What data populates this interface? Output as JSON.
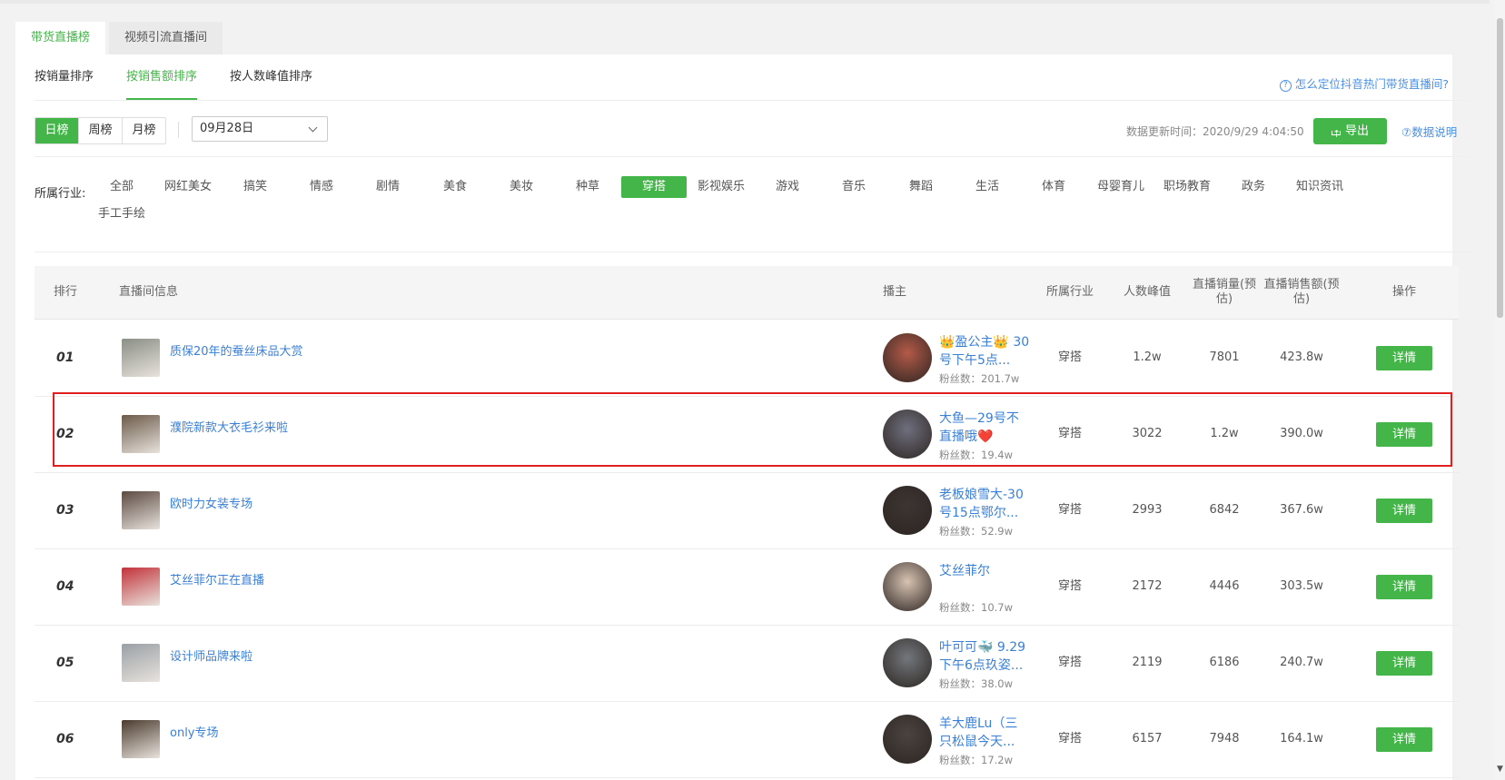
{
  "top_tabs": [
    "带货直播榜",
    "视频引流直播间"
  ],
  "sort_tabs": [
    "按销量排序",
    "按销售额排序",
    "按人数峰值排序"
  ],
  "help_link": "怎么定位抖音热门带货直播间?",
  "period_buttons": [
    "日榜",
    "周榜",
    "月榜"
  ],
  "date_value": "09月28日",
  "update_time": "数据更新时间：2020/9/29 4:04:50",
  "export_label": "导出",
  "data_explain": "⑦数据说明",
  "industry_label": "所属行业:",
  "industries": [
    "全部",
    "网红美女",
    "搞笑",
    "情感",
    "剧情",
    "美食",
    "美妆",
    "种草",
    "穿搭",
    "影视娱乐",
    "游戏",
    "音乐",
    "舞蹈",
    "生活",
    "体育",
    "母婴育儿",
    "职场教育",
    "政务",
    "知识资讯",
    "手工手绘"
  ],
  "active_industry": "穿搭",
  "table": {
    "headers": {
      "rank": "排行",
      "room": "直播间信息",
      "streamer": "播主",
      "industry": "所属行业",
      "peak": "人数峰值",
      "sales_volume": "直播销量(预估)",
      "sales_amount": "直播销售额(预估)",
      "action": "操作"
    },
    "rows": [
      {
        "rank": "01",
        "title": "质保20年的蚕丝床品大赏",
        "streamer": "👑盈公主👑 30号下午5点...",
        "fans": "粉丝数：201.7w",
        "industry": "穿搭",
        "peak": "1.2w",
        "volume": "7801",
        "amount": "423.8w",
        "btn": "详情"
      },
      {
        "rank": "02",
        "title": "濮院新款大衣毛衫来啦",
        "streamer": "大鱼—29号不直播哦❤️",
        "fans": "粉丝数：19.4w",
        "industry": "穿搭",
        "peak": "3022",
        "volume": "1.2w",
        "amount": "390.0w",
        "btn": "详情"
      },
      {
        "rank": "03",
        "title": "欧时力女装专场",
        "streamer": "老板娘雪大-30号15点鄂尔...",
        "fans": "粉丝数：52.9w",
        "industry": "穿搭",
        "peak": "2993",
        "volume": "6842",
        "amount": "367.6w",
        "btn": "详情"
      },
      {
        "rank": "04",
        "title": "艾丝菲尔正在直播",
        "streamer": "艾丝菲尔",
        "fans": "粉丝数：10.7w",
        "industry": "穿搭",
        "peak": "2172",
        "volume": "4446",
        "amount": "303.5w",
        "btn": "详情"
      },
      {
        "rank": "05",
        "title": "设计师品牌来啦",
        "streamer": "叶可可🐳 9.29下午6点玖姿...",
        "fans": "粉丝数：38.0w",
        "industry": "穿搭",
        "peak": "2119",
        "volume": "6186",
        "amount": "240.7w",
        "btn": "详情"
      },
      {
        "rank": "06",
        "title": "only专场",
        "streamer": "羊大鹿Lu（三只松鼠今天...",
        "fans": "粉丝数：17.2w",
        "industry": "穿搭",
        "peak": "6157",
        "volume": "7948",
        "amount": "164.1w",
        "btn": "详情"
      }
    ]
  },
  "colors": {
    "accent": "#44b549",
    "link": "#3a80d6",
    "highlight": "#e0201e"
  }
}
